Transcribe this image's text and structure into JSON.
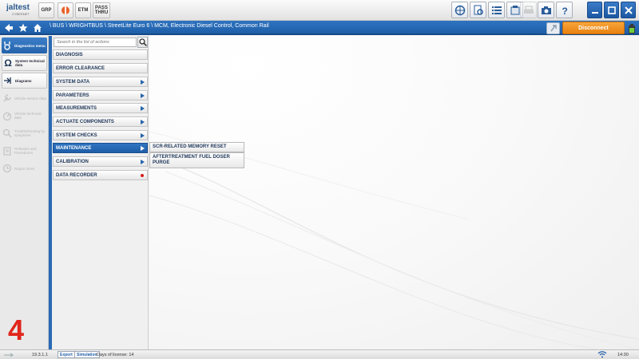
{
  "app": {
    "logo_text": "jaltest",
    "logo_sub": "CYBERNET"
  },
  "toolbar": {
    "left_buttons": [
      {
        "label": "GRP"
      },
      {
        "label": ""
      },
      {
        "label": "ETM"
      },
      {
        "label": "PASS THRU"
      }
    ],
    "right_icons": [
      "network-globe-icon",
      "doc-search-icon",
      "list-icon",
      "tablet-icon",
      "printer-icon",
      "camera-icon",
      "help-icon"
    ],
    "window_icons": [
      "minimize-icon",
      "maximize-icon",
      "close-icon"
    ]
  },
  "breadcrumb": {
    "text": "\\ BUS \\ WRIGHTBUS \\ StreetLite Euro 6 \\ MCM, Electronic Diesel Control, Common Rail",
    "disconnect_label": "Disconnect"
  },
  "sidebar": {
    "items": [
      {
        "label": "Diagnostics menu",
        "state": "active"
      },
      {
        "label": "System technical data",
        "state": "normal"
      },
      {
        "label": "Diagrams",
        "state": "normal"
      },
      {
        "label": "Vehicle service data",
        "state": "disabled"
      },
      {
        "label": "Vehicle technical data",
        "state": "disabled"
      },
      {
        "label": "Troubleshooting by symptoms",
        "state": "disabled"
      },
      {
        "label": "Releases and Procedures",
        "state": "disabled"
      },
      {
        "label": "Repair times",
        "state": "disabled"
      }
    ],
    "step_number": "4"
  },
  "menu": {
    "search_placeholder": "Search in the list of actions",
    "items": [
      {
        "label": "DIAGNOSIS",
        "indicator": "none"
      },
      {
        "label": "ERROR CLEARANCE",
        "indicator": "none"
      },
      {
        "label": "SYSTEM DATA",
        "indicator": "arrow"
      },
      {
        "label": "PARAMETERS",
        "indicator": "arrow"
      },
      {
        "label": "MEASUREMENTS",
        "indicator": "arrow"
      },
      {
        "label": "ACTUATE COMPONENTS",
        "indicator": "arrow"
      },
      {
        "label": "SYSTEM CHECKS",
        "indicator": "arrow"
      },
      {
        "label": "MAINTENANCE",
        "indicator": "arrow",
        "selected": true
      },
      {
        "label": "CALIBRATION",
        "indicator": "arrow"
      },
      {
        "label": "DATA RECORDER",
        "indicator": "dot"
      }
    ]
  },
  "submenu": {
    "items": [
      {
        "label": "SCR-RELATED MEMORY RESET"
      },
      {
        "label": "AFTERTREATMENT FUEL DOSER PURGE"
      }
    ]
  },
  "status": {
    "version": "19.3.1.1",
    "export_label": "Export",
    "simulation_label": "Simulation",
    "license": "Days of license: 14",
    "time": "14:30"
  },
  "colors": {
    "accent": "#1f5ea8",
    "disconnect": "#ef8f1f",
    "data_recorder_dot": "#d0201c",
    "step_number": "#e0261b"
  }
}
